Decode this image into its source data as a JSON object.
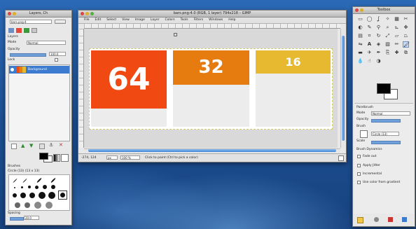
{
  "left_panel": {
    "title": "Layers, Ch",
    "image_selector": "bars.png-4",
    "tab_label": "Layers",
    "mode_label": "Mode",
    "mode_value": "Normal",
    "opacity_label": "Opacity",
    "opacity_value": "100.0",
    "lock_label": "Lock",
    "layer_name": "Background",
    "brushes_title": "Brushes",
    "brush_name": "Circle (13) (13 x 13)",
    "spacing_label": "Spacing",
    "spacing_value": "20.0"
  },
  "image_window": {
    "title": "bars.png-4.0 (RGB, 1 layer) 794x218 – GIMP",
    "menu": [
      "File",
      "Edit",
      "Select",
      "View",
      "Image",
      "Layer",
      "Colors",
      "Tools",
      "Filters",
      "Windows",
      "Help"
    ],
    "blocks": [
      {
        "label": "64",
        "color": "#f04a12"
      },
      {
        "label": "32",
        "color": "#e67c10"
      },
      {
        "label": "16",
        "color": "#e7b930"
      }
    ],
    "status_unit": "px",
    "zoom_value": "100 %",
    "status_text": "Click to paint (Ctrl to pick a color)",
    "coords": "-274, 124"
  },
  "toolbox": {
    "title": "Toolbox",
    "tool_options_title": "Paintbrush",
    "mode_label": "Mode",
    "mode_value": "Normal",
    "opacity_label": "Opacity",
    "brush_label": "Brush",
    "brush_value": "Circle (13)",
    "scale_label": "Scale",
    "dynamics_label": "Brush Dynamics",
    "fade_label": "Fade out",
    "jitter_label": "Apply Jitter",
    "incremental_label": "Incremental",
    "gradient_label": "Use color from gradient"
  },
  "colors": {
    "fg": "#000000",
    "bg": "#ffffff",
    "accent": "#2d73c8"
  }
}
